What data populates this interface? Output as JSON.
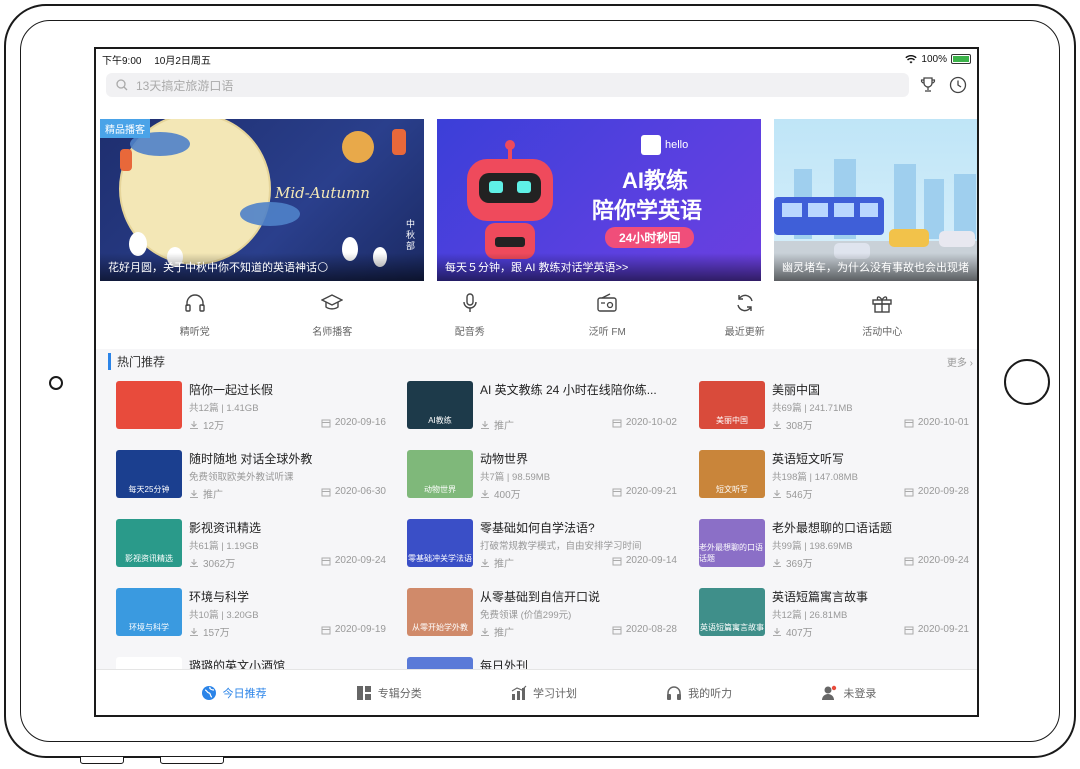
{
  "status": {
    "time": "下午9:00",
    "date": "10月2日周五",
    "battery": "100%"
  },
  "search": {
    "placeholder": "13天搞定旅游口语"
  },
  "banners": [
    {
      "tag": "精品播客",
      "caption": "花好月圆，关于中秋中你不知道的英语神话🌕",
      "vertical_text": "中秋部",
      "art_text": "Mid-Autumn"
    },
    {
      "caption": "每天５分钟，跟 AI 教练对话学英语>>",
      "brand": "hello",
      "headline1": "AI教练",
      "headline2": "陪你学英语",
      "cta": "24小时秒回"
    },
    {
      "caption": "幽灵堵车，为什么没有事故也会出现堵"
    }
  ],
  "categories": [
    {
      "label": "精听党",
      "icon": "headphone-icon"
    },
    {
      "label": "名师播客",
      "icon": "graduation-cap-icon"
    },
    {
      "label": "配音秀",
      "icon": "microphone-icon"
    },
    {
      "label": "泛听 FM",
      "icon": "radio-icon"
    },
    {
      "label": "最近更新",
      "icon": "refresh-icon"
    },
    {
      "label": "活动中心",
      "icon": "gift-icon"
    }
  ],
  "section": {
    "title": "热门推荐",
    "more": "更多"
  },
  "items": [
    {
      "title": "陪你一起过长假",
      "meta": "共12篇 | 1.41GB",
      "stat": "12万",
      "date": "2020-09-16",
      "thumb_label": "",
      "color": "#e84b3c"
    },
    {
      "title": "AI 英文教练 24 小时在线陪你练...",
      "meta": "",
      "stat": "推广",
      "date": "2020-10-02",
      "thumb_label": "AI教练",
      "color": "#1d3a4a"
    },
    {
      "title": "美丽中国",
      "meta": "共69篇 | 241.71MB",
      "stat": "308万",
      "date": "2020-10-01",
      "thumb_label": "美丽中国",
      "color": "#d94b3b"
    },
    {
      "title": "随时随地 对话全球外教",
      "meta": "免费领取欧美外教试听课",
      "stat": "推广",
      "date": "2020-06-30",
      "thumb_label": "每天25分钟",
      "color": "#1b3f8f"
    },
    {
      "title": "动物世界",
      "meta": "共7篇 | 98.59MB",
      "stat": "400万",
      "date": "2020-09-21",
      "thumb_label": "动物世界",
      "color": "#7fb87a"
    },
    {
      "title": "英语短文听写",
      "meta": "共198篇 | 147.08MB",
      "stat": "546万",
      "date": "2020-09-28",
      "thumb_label": "短文听写",
      "color": "#c9853a"
    },
    {
      "title": "影视资讯精选",
      "meta": "共61篇 | 1.19GB",
      "stat": "3062万",
      "date": "2020-09-24",
      "thumb_label": "影视资讯精选",
      "color": "#2a9a8a"
    },
    {
      "title": "零基础如何自学法语?",
      "meta": "打破常规教学模式，自由安排学习时间",
      "stat": "推广",
      "date": "2020-09-14",
      "thumb_label": "零基础冲关学法语",
      "color": "#3a4fc7"
    },
    {
      "title": "老外最想聊的口语话题",
      "meta": "共99篇 | 198.69MB",
      "stat": "369万",
      "date": "2020-09-24",
      "thumb_label": "老外最想聊的口语话题",
      "color": "#8b6fc7"
    },
    {
      "title": "环境与科学",
      "meta": "共10篇 | 3.20GB",
      "stat": "157万",
      "date": "2020-09-19",
      "thumb_label": "环境与科学",
      "color": "#3a9ae0"
    },
    {
      "title": "从零基础到自信开口说",
      "meta": "免费领课 (价值299元)",
      "stat": "推广",
      "date": "2020-08-28",
      "thumb_label": "从零开始学外教",
      "color": "#d08a6a"
    },
    {
      "title": "英语短篇寓言故事",
      "meta": "共12篇 | 26.81MB",
      "stat": "407万",
      "date": "2020-09-21",
      "thumb_label": "英语短篇寓言故事",
      "color": "#3f8f8a"
    },
    {
      "title": "璐璐的英文小酒馆",
      "meta": "",
      "stat": "",
      "date": "",
      "thumb_label": "",
      "color": "#ffffff"
    },
    {
      "title": "每日外刊",
      "meta": "",
      "stat": "",
      "date": "",
      "thumb_label": "",
      "color": "#5a7ad8"
    }
  ],
  "tabs": [
    {
      "label": "今日推荐",
      "icon": "globe-icon",
      "active": true
    },
    {
      "label": "专辑分类",
      "icon": "grid-icon",
      "active": false
    },
    {
      "label": "学习计划",
      "icon": "chart-icon",
      "active": false
    },
    {
      "label": "我的听力",
      "icon": "headphone-icon",
      "active": false
    },
    {
      "label": "未登录",
      "icon": "user-icon",
      "active": false
    }
  ]
}
